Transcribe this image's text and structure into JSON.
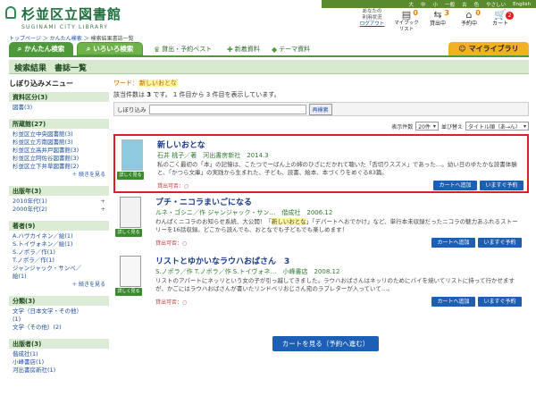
{
  "header": {
    "logo_jp": "杉並区立図書館",
    "logo_en": "SUGINAMI CITY LIBRARY",
    "topbar": [
      "大",
      "中",
      "小",
      "一般",
      "古",
      "色",
      "やさしい",
      "English"
    ],
    "status_line1": "あなたの",
    "status_line2": "利用状況",
    "login": "ログアウト",
    "icons": [
      {
        "label": "マイブックリスト",
        "count": "0",
        "icon": "book-stack-icon"
      },
      {
        "label": "貸出中",
        "count": "3",
        "icon": "lending-icon"
      },
      {
        "label": "予約中",
        "count": "0",
        "icon": "reservation-icon"
      },
      {
        "label": "カート",
        "count": "2",
        "icon": "cart-icon"
      }
    ]
  },
  "breadcrumb": {
    "home": "トップページ",
    "sep1": " ＞ ",
    "search": "かんたん検索",
    "sep2": " ＞ ",
    "current": "検索結果書誌一覧"
  },
  "nav": {
    "simple": "かんたん検索",
    "advanced": "いろいろ検索",
    "best": "貸出・予約ベスト",
    "newbooks": "新着資料",
    "theme": "テーマ資料",
    "mylib": "マイライブラリ"
  },
  "title": "検索結果　書誌一覧",
  "sidebar": {
    "title": "しぼり込みメニュー",
    "facets": [
      {
        "head": "資料区分(3)",
        "rows": [
          {
            "label": "図書(3)",
            "plus": ""
          }
        ],
        "more": ""
      },
      {
        "head": "所蔵館(27)",
        "rows": [
          {
            "label": "杉並区立中央図書館(3)",
            "plus": ""
          },
          {
            "label": "杉並区立方南図書館(3)",
            "plus": ""
          },
          {
            "label": "杉並区立高井戸図書館(3)",
            "plus": ""
          },
          {
            "label": "杉並区立阿佐谷図書館(3)",
            "plus": ""
          },
          {
            "label": "杉並区立下井草図書館(2)",
            "plus": ""
          }
        ],
        "more": "＋ 続きを見る"
      },
      {
        "head": "出版年(3)",
        "rows": [
          {
            "label": "2010年代(1)",
            "plus": "+"
          },
          {
            "label": "2000年代(2)",
            "plus": "+"
          }
        ],
        "more": ""
      },
      {
        "head": "著者(9)",
        "rows": [
          {
            "label": "A.ハヴカイネン／絵(1)",
            "plus": ""
          },
          {
            "label": "S.トイヴォネン／絵(1)",
            "plus": ""
          },
          {
            "label": "S.ノポラ／作(1)",
            "plus": ""
          },
          {
            "label": "T.ノポラ／作(1)",
            "plus": ""
          },
          {
            "label": "ジャンジャック・サンペ／",
            "plus": ""
          },
          {
            "label": "絵(1)",
            "plus": ""
          }
        ],
        "more": "＋ 続きを見る"
      },
      {
        "head": "分類(3)",
        "rows": [
          {
            "label": "文学（日本文学・その他）",
            "plus": ""
          },
          {
            "label": "(1)",
            "plus": ""
          },
          {
            "label": "文学（その他）(2)",
            "plus": ""
          }
        ],
        "more": ""
      },
      {
        "head": "出版者(3)",
        "rows": [
          {
            "label": "偕成社(1)",
            "plus": ""
          },
          {
            "label": "小峰書店(1)",
            "plus": ""
          },
          {
            "label": "河出書房新社(1)",
            "plus": ""
          }
        ],
        "more": ""
      }
    ]
  },
  "main": {
    "word_label": "ワード：",
    "word_value": "新しいおとな",
    "count_pre": "該当件数は",
    "count_num": "3",
    "count_post": "です。 1 件目から 3 件目を表示しています。",
    "refine_label": "しぼり込み",
    "refine_placeholder": "",
    "refine_button": "再検索",
    "per_page_label": "表示件数",
    "per_page": "20件",
    "sort_label": "並び替え",
    "sort_value": "タイトル順（あ→ん）"
  },
  "results": [
    {
      "title": "新しいおとな",
      "meta": "石井 桃子／著　河出書房新社　2014.3",
      "desc_a": "私のごく最初の「本」の記憶は、こたつでーばん上の姉のひざにだかれて聴いた「舌切りスズメ」であった…。幼い日のゆたかな読書体験と、「かつら文庫」の実践から生まれた、子ども、読書、絵本、本づくりをめぐる83篇。",
      "desc_kw": "",
      "desc_b": "",
      "avail": "貸出可否：○",
      "details": "詳しく見る"
    },
    {
      "title": "プチ・ニコラまいごになる",
      "meta": "ルネ・ゴシニ／作 ジャンジャック・サン…　偕成社　2006.12",
      "desc_a": "わんぱくニコラのお知らせ系統、大公開！「",
      "desc_kw": "新しいおとな",
      "desc_b": "」「デパートへおでかけ」など、単行本未収録だったニコラの魅力あふれるストーリーを16話収録。どこから読んでも、おとなでも子どもでも楽しめます！",
      "avail": "貸出可否：○",
      "details": "詳しく見る"
    },
    {
      "title": "リストとゆかいなラウハおばさん　3",
      "meta": "S.ノポラ／作 T.ノポラ／作 S.トイヴォネ…　小峰書店　2008.12",
      "desc_a": "リストのアパートにネッリという女の子が引っ越してきました。ラウハおばさんはネッリのためにパイを焼いてリストに持って行かせますが、かごにはラウハおばさんが書いたリンドベリおじさん宛のラブレターが入っていて…。",
      "desc_kw": "",
      "desc_b": "",
      "avail": "貸出可否：○",
      "details": "詳しく見る"
    }
  ],
  "buttons": {
    "add_cart": "カートへ追加",
    "reserve": "いますぐ予約",
    "view_cart": "カートを見る（予約へ進む）"
  }
}
